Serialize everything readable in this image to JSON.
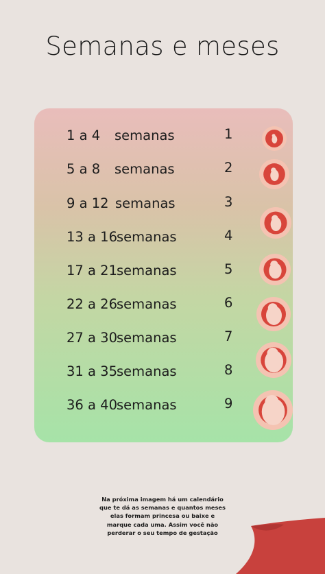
{
  "title": "Semanas e meses",
  "table": {
    "rows": [
      {
        "range": "1 a 4",
        "unit": "semanas",
        "month": "1"
      },
      {
        "range": "5 a 8",
        "unit": "semanas",
        "month": "2"
      },
      {
        "range": "9 a 12",
        "unit": "semanas",
        "month": "3"
      },
      {
        "range": "13 a 16",
        "unit": "semanas",
        "month": "4"
      },
      {
        "range": "17 a 21",
        "unit": "semanas",
        "month": "5"
      },
      {
        "range": "22 a 26",
        "unit": "semanas",
        "month": "6"
      },
      {
        "range": "27 a 30",
        "unit": "semanas",
        "month": "7"
      },
      {
        "range": "31 a 35",
        "unit": "semanas",
        "month": "8"
      },
      {
        "range": "36 a 40",
        "unit": "semanas",
        "month": "9"
      }
    ]
  },
  "footer_note": "Na próxima imagem há um calendário que te dá as semanas e quantos meses elas formam princesa ou baixe e marque cada uma. Assim você não perderar o seu tempo de gestação",
  "colors": {
    "background": "#e9e3df",
    "card_top": "#e9bdbb",
    "card_bottom": "#a6e3a8",
    "womb_outer": "#f4c3b2",
    "womb_inner": "#d8453b",
    "page_curl": "#c8413d"
  },
  "icons": [
    "fetus-month-icon",
    "page-curl-decoration"
  ]
}
